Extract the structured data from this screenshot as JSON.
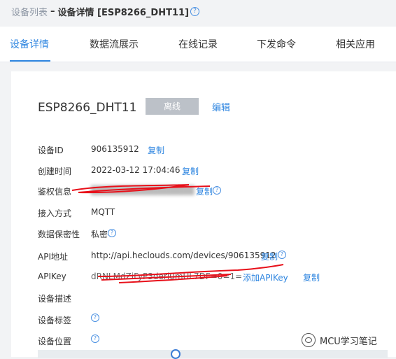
{
  "breadcrumb": {
    "parent": "设备列表",
    "separator": "–",
    "current": "设备详情 [ESP8266_DHT11]",
    "help": "?"
  },
  "tabs": [
    {
      "label": "设备详情",
      "active": true
    },
    {
      "label": "数据流展示",
      "active": false
    },
    {
      "label": "在线记录",
      "active": false
    },
    {
      "label": "下发命令",
      "active": false
    },
    {
      "label": "相关应用",
      "active": false
    }
  ],
  "device": {
    "name": "ESP8266_DHT11",
    "status": "离线",
    "edit": "编辑"
  },
  "fields": {
    "device_id": {
      "label": "设备ID",
      "value": "906135912",
      "action": "复制"
    },
    "created": {
      "label": "创建时间",
      "value": "2022-03-12 17:04:46",
      "action": "复制"
    },
    "auth": {
      "label": "鉴权信息",
      "value": "",
      "action": "复制"
    },
    "access": {
      "label": "接入方式",
      "value": "MQTT"
    },
    "privacy": {
      "label": "数据保密性",
      "value": "私密"
    },
    "api_url": {
      "label": "API地址",
      "value": "http://api.heclouds.com/devices/906135912",
      "action": "复制"
    },
    "api_key": {
      "label": "APIKey",
      "value": "dRNLMdZiFyP3deri0mUL7DF=0=1=",
      "add": "添加APIKey",
      "action": "复制"
    },
    "desc": {
      "label": "设备描述"
    },
    "tags": {
      "label": "设备标签"
    },
    "location": {
      "label": "设备位置"
    }
  },
  "watermark": "MCU学习笔记",
  "colors": {
    "accent": "#2f86e0",
    "status_offline": "#bcc1c8",
    "redaction": "#e8101a"
  }
}
